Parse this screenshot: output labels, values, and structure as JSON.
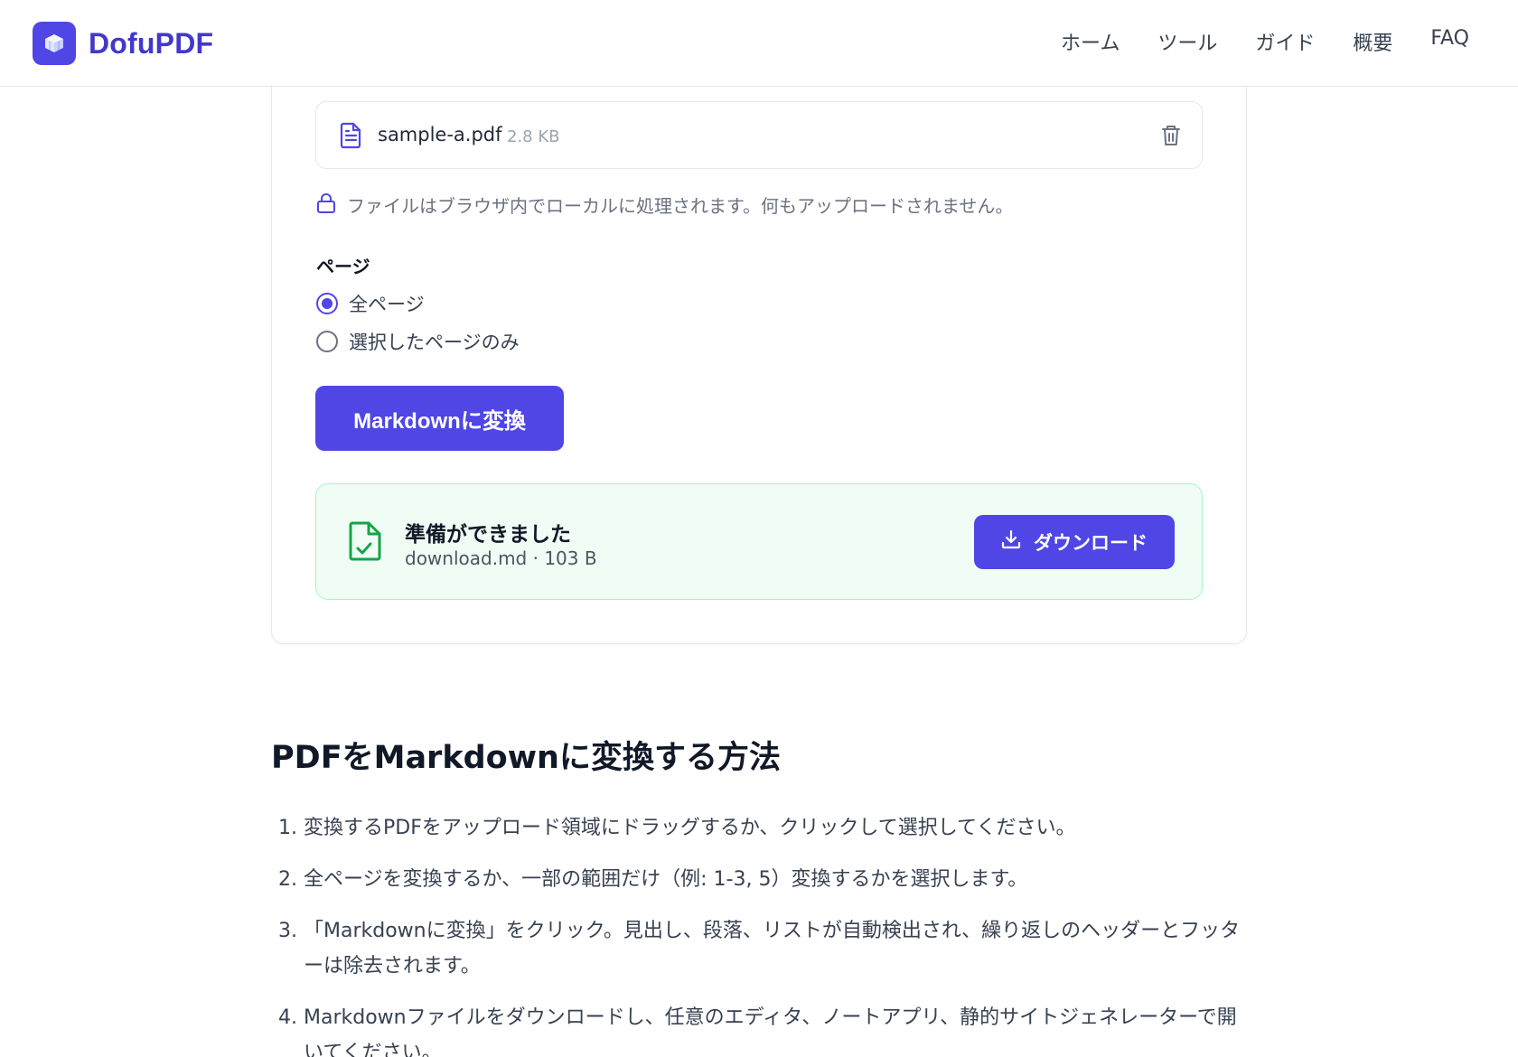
{
  "brand": {
    "name": "DofuPDF"
  },
  "nav": [
    "ホーム",
    "ツール",
    "ガイド",
    "概要",
    "FAQ"
  ],
  "file": {
    "name": "sample-a.pdf",
    "size": "2.8 KB"
  },
  "privacy_note": "ファイルはブラウザ内でローカルに処理されます。何もアップロードされません。",
  "pages": {
    "label": "ページ",
    "options": [
      {
        "label": "全ページ",
        "checked": true
      },
      {
        "label": "選択したページのみ",
        "checked": false
      }
    ]
  },
  "convert_button": "Markdownに変換",
  "result": {
    "title": "準備ができました",
    "meta": "download.md · 103 B",
    "download_label": "ダウンロード"
  },
  "howto": {
    "title": "PDFをMarkdownに変換する方法",
    "steps": [
      {
        "num": "1.",
        "text": "変換するPDFをアップロード領域にドラッグするか、クリックして選択してください。"
      },
      {
        "num": "2.",
        "text": "全ページを変換するか、一部の範囲だけ（例: 1-3, 5）変換するかを選択します。"
      },
      {
        "num": "3.",
        "text": "「Markdownに変換」をクリック。見出し、段落、リストが自動検出され、繰り返しのヘッダーとフッターは除去されます。"
      },
      {
        "num": "4.",
        "text": "Markdownファイルをダウンロードし、任意のエディタ、ノートアプリ、静的サイトジェネレーターで開いてください。"
      }
    ]
  },
  "colors": {
    "accent": "#4f46e5",
    "success_bg": "#f0fdf4",
    "success_icon": "#16a34a"
  }
}
